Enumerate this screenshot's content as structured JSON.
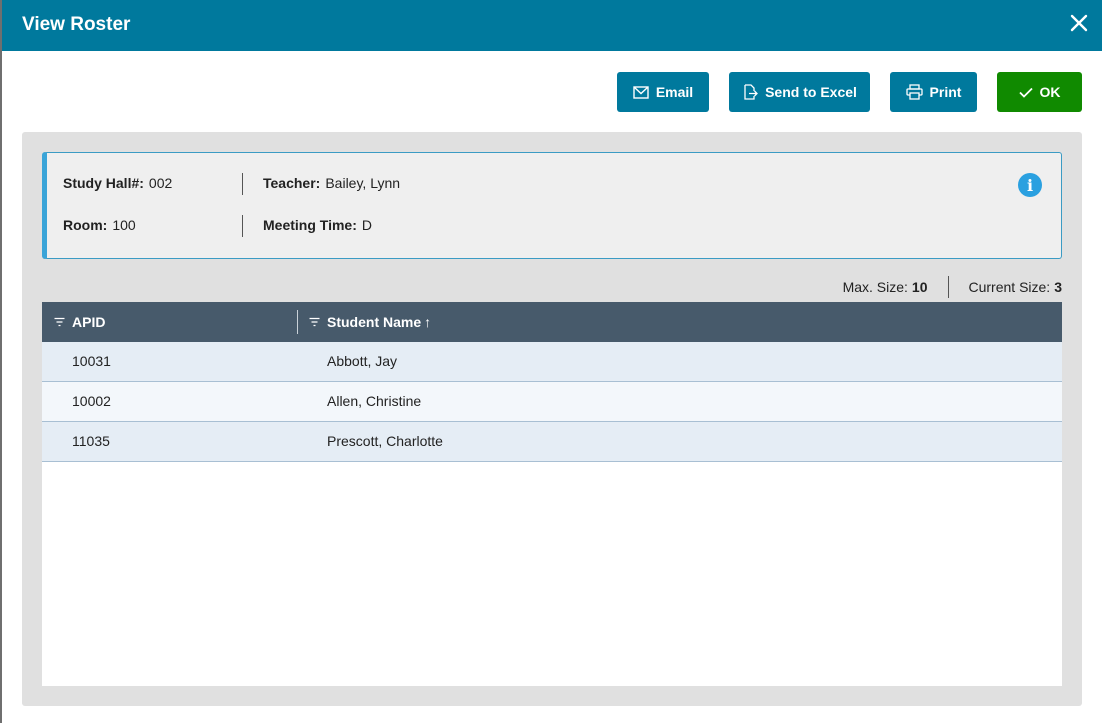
{
  "modal": {
    "title": "View Roster"
  },
  "toolbar": {
    "email_label": "Email",
    "excel_label": "Send to Excel",
    "print_label": "Print",
    "ok_label": "OK"
  },
  "info": {
    "study_hall_label": "Study Hall#:",
    "study_hall_value": "002",
    "teacher_label": "Teacher:",
    "teacher_value": "Bailey, Lynn",
    "room_label": "Room:",
    "room_value": "100",
    "meeting_label": "Meeting Time:",
    "meeting_value": "D",
    "info_icon_glyph": "i"
  },
  "size": {
    "max_label": "Max. Size:",
    "max_value": "10",
    "current_label": "Current Size:",
    "current_value": "3"
  },
  "grid": {
    "columns": [
      {
        "label": "APID"
      },
      {
        "label": "Student Name",
        "sort": "↑"
      }
    ],
    "rows": [
      {
        "apid": "10031",
        "name": "Abbott, Jay"
      },
      {
        "apid": "10002",
        "name": "Allen, Christine"
      },
      {
        "apid": "11035",
        "name": "Prescott, Charlotte"
      }
    ]
  },
  "colors": {
    "header": "#00799d",
    "ok_button": "#108a00",
    "grid_header": "#475a6b",
    "info_accent": "#3aa4d8"
  },
  "icons": {
    "close": "close-icon",
    "email": "envelope-icon",
    "excel": "export-icon",
    "print": "printer-icon",
    "ok": "checkmark-icon",
    "info": "info-icon",
    "filter": "filter-icon"
  }
}
